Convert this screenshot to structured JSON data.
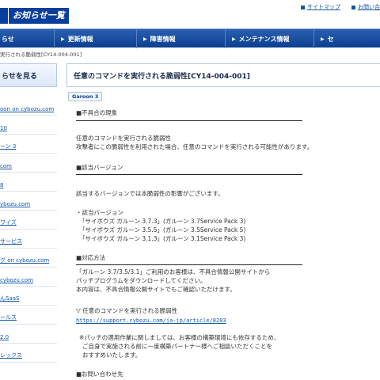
{
  "header": {
    "title": "お知らせ一覧",
    "links": [
      "サイトマップ",
      "お問い合"
    ]
  },
  "nav": {
    "items": [
      "らせ",
      "更新情報",
      "障害情報",
      "メンテナンス情報",
      "セ"
    ]
  },
  "breadcrumb": "実行される脆弱性[CY14-004-001]",
  "sidebar": {
    "heading": "らせを見る",
    "items": [
      "oon on cybozu.com",
      "10",
      "ーン 3",
      "com",
      "8",
      "ybozu.com",
      "ワイズ",
      "サービス",
      "グ on cybozu.com",
      "cybozu.com",
      "んSaaS",
      "ールス",
      "2.0",
      "レックス"
    ]
  },
  "main": {
    "title": "任意のコマンドを実行される脆弱性[CY14-004-001]",
    "badge": "Garoon 3",
    "sections": {
      "symptom": {
        "heading": "■不具合の現象",
        "lines": [
          "任意のコマンドを実行される脆弱性",
          "攻撃者にこの脆弱性を利用された場合、任意のコマンドを実行される可能性があります。"
        ]
      },
      "versions": {
        "heading": "■該当バージョン",
        "intro": "該当するバージョンでは本脆弱性の影響がございます。",
        "label": "・該当バージョン",
        "items": [
          "「サイボウズ ガルーン 3.7.3」(ガルーン 3.7Service Pack 3)",
          "「サイボウズ ガルーン 3.5.5」(ガルーン 3.5Service Pack 5)",
          "「サイボウズ ガルーン 3.1.3」(ガルーン 3.1Service Pack 3)"
        ]
      },
      "response": {
        "heading": "■対応方法",
        "lines": [
          "「ガルーン 3.7/3.5/3.1」ご利用のお客様は、不具合情報公開サイトから",
          "パッチプログラムをダウンロードしてください。",
          "本内容は、不具合情報公開サイトでもご確認いただけます。"
        ],
        "link_label": "▽ 任意のコマンドを実行される脆弱性",
        "link_url": "https://support.cybozu.com/ja-jp/article/8203",
        "notes": [
          "※パッチの適用作業に関しましては、お客様の構築環境にも依存するため、",
          "ご自身で実施される前に一度構築パートナー様へご相談いただくことを",
          "おすすめいたします。"
        ]
      },
      "contact": {
        "heading": "■お問い合わせ先"
      }
    }
  }
}
